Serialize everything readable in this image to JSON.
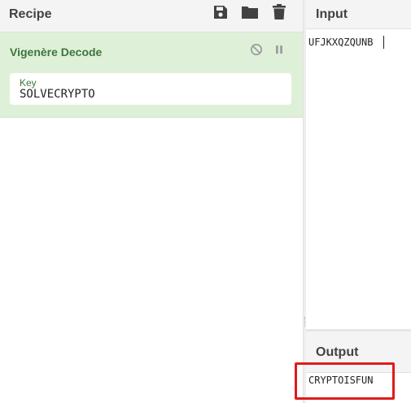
{
  "recipe": {
    "title": "Recipe",
    "icons": [
      "save-icon",
      "folder-icon",
      "trash-icon"
    ]
  },
  "operation": {
    "name": "Vigenère Decode",
    "controls": [
      "disable-icon",
      "pause-icon"
    ],
    "argument": {
      "label": "Key",
      "value": "SOLVECRYPTO"
    }
  },
  "input": {
    "title": "Input",
    "value": "UFJKXQZQUNB"
  },
  "output": {
    "title": "Output",
    "value": "CRYPTOISFUN"
  },
  "colors": {
    "operation_bg": "#dff0d8",
    "operation_text": "#3c763d",
    "highlight": "#e01b1b",
    "header_bg": "#f4f4f4"
  }
}
